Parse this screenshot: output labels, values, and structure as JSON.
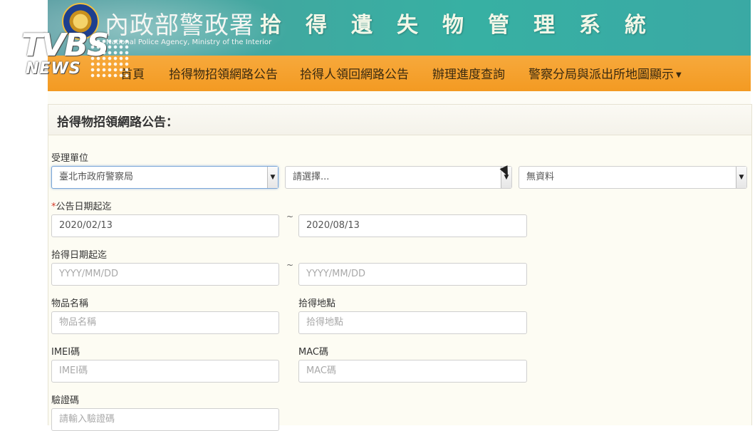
{
  "header": {
    "agency_cn": "內政部警政署",
    "agency_en": "National Police Agency, Ministry of the Interior",
    "system_title": "拾得遺失物管理系統"
  },
  "watermark": {
    "line1": "TVBS",
    "line2": "NEWS"
  },
  "nav": {
    "items": [
      {
        "label": "首頁"
      },
      {
        "label": "拾得物招領網路公告"
      },
      {
        "label": "拾得人領回網路公告"
      },
      {
        "label": "辦理進度查詢"
      },
      {
        "label": "警察分局與派出所地圖顯示"
      }
    ]
  },
  "panel": {
    "title": "拾得物招領網路公告："
  },
  "form": {
    "unit_label": "受理單位",
    "unit_select1": "臺北市政府警察局",
    "unit_select2": "請選擇...",
    "unit_select3": "無資料",
    "announce_label_star": "*",
    "announce_label": "公告日期起迄",
    "announce_from": "2020/02/13",
    "announce_to": "2020/08/13",
    "tilde": "~",
    "found_label": "拾得日期起迄",
    "found_from_ph": "YYYY/MM/DD",
    "found_to_ph": "YYYY/MM/DD",
    "item_label": "物品名稱",
    "item_ph": "物品名稱",
    "place_label": "拾得地點",
    "place_ph": "拾得地點",
    "imei_label": "IMEI碼",
    "imei_ph": "IMEI碼",
    "mac_label": "MAC碼",
    "mac_ph": "MAC碼",
    "captcha_label": "驗證碼",
    "captcha_ph": "請輸入驗證碼"
  }
}
